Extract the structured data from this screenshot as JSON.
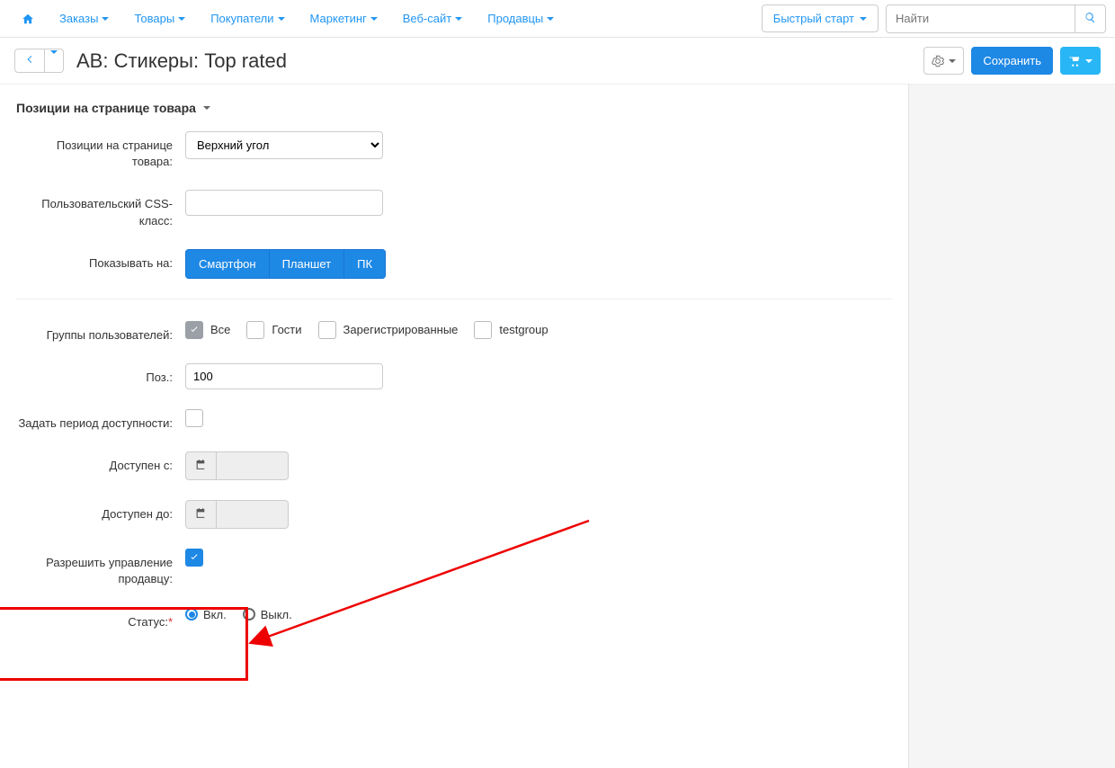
{
  "nav": {
    "orders": "Заказы",
    "products": "Товары",
    "customers": "Покупатели",
    "marketing": "Маркетинг",
    "website": "Веб-сайт",
    "vendors": "Продавцы"
  },
  "topbar": {
    "quick_start": "Быстрый старт",
    "search_placeholder": "Найти"
  },
  "header": {
    "title": "AB: Стикеры: Top rated",
    "save": "Сохранить"
  },
  "section": {
    "title": "Позиции на странице товара"
  },
  "form": {
    "position_label": "Позиции на странице товара:",
    "position_value": "Верхний угол",
    "css_label": "Пользовательский CSS-класс:",
    "css_value": "",
    "show_on_label": "Показывать на:",
    "show_on": {
      "phone": "Смартфон",
      "tablet": "Планшет",
      "pc": "ПК"
    },
    "groups_label": "Группы пользователей:",
    "groups": {
      "all": "Все",
      "guests": "Гости",
      "registered": "Зарегистрированные",
      "test": "testgroup"
    },
    "pos_label": "Поз.:",
    "pos_value": "100",
    "period_label": "Задать период доступности:",
    "avail_from_label": "Доступен с:",
    "avail_to_label": "Доступен до:",
    "vendor_manage_label": "Разрешить управление продавцу:",
    "status_label": "Статус:",
    "status_on": "Вкл.",
    "status_off": "Выкл."
  }
}
